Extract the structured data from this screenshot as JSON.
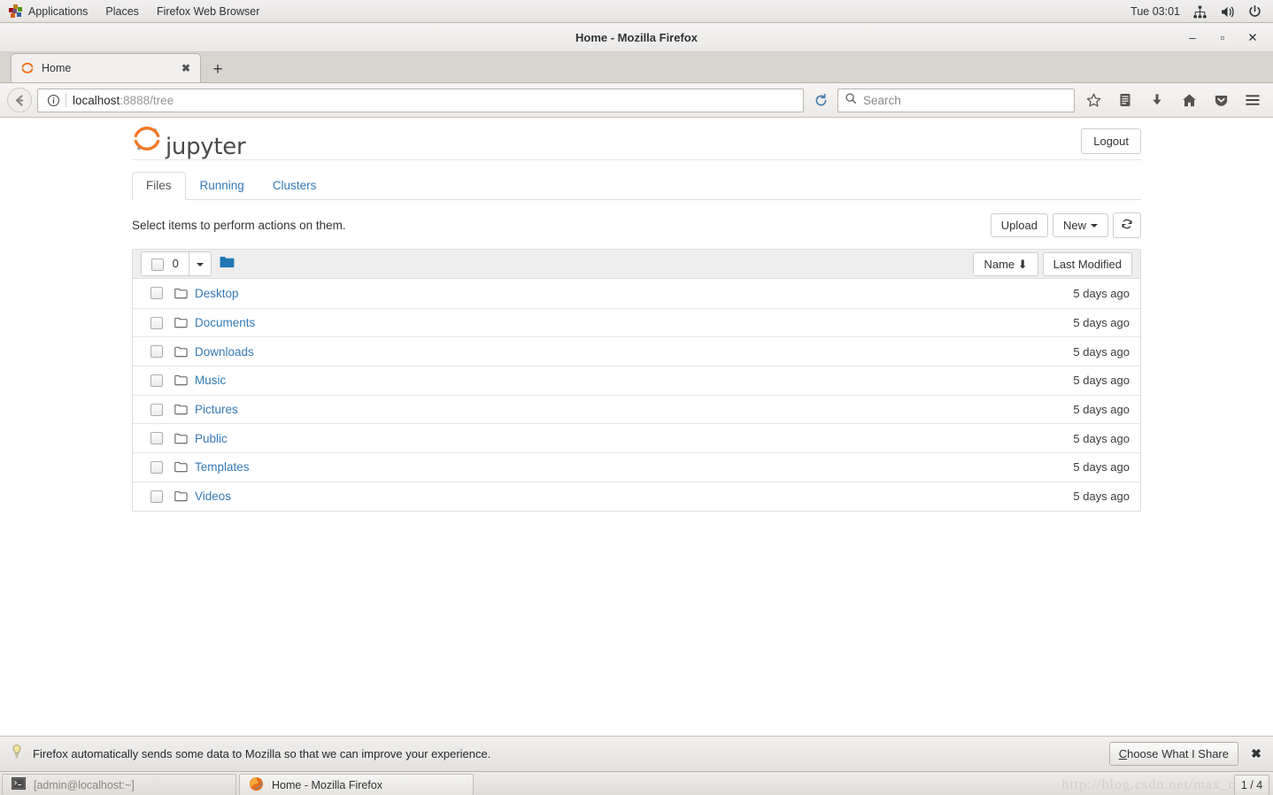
{
  "desktop_panel": {
    "menus": [
      "Applications",
      "Places",
      "Firefox Web Browser"
    ],
    "clock": "Tue 03:01",
    "tray_icons": [
      "network-icon",
      "volume-icon",
      "power-icon"
    ]
  },
  "browser": {
    "window_title": "Home - Mozilla Firefox",
    "window_controls": {
      "minimize": "–",
      "maximize": "▫",
      "close": "✕"
    },
    "tab": {
      "title": "Home",
      "close_label": "✖",
      "favicon": "jupyter-favicon"
    },
    "new_tab_label": "+",
    "url": {
      "host": "localhost",
      "rest": ":8888/tree"
    },
    "search": {
      "placeholder": "Search",
      "value": ""
    },
    "toolbar_icons": [
      "back-icon",
      "site-info-icon",
      "reload-icon",
      "search-icon",
      "bookmark-star-icon",
      "library-icon",
      "downloads-icon",
      "home-icon",
      "pocket-icon",
      "menu-icon"
    ]
  },
  "jupyter": {
    "brand": "jupyter",
    "logout_label": "Logout",
    "tabs": [
      {
        "label": "Files",
        "active": true
      },
      {
        "label": "Running",
        "active": false
      },
      {
        "label": "Clusters",
        "active": false
      }
    ],
    "select_message": "Select items to perform actions on them.",
    "actions": {
      "upload_label": "Upload",
      "new_label": "New",
      "refresh_label": "refresh-icon"
    },
    "list_toolbar": {
      "selected_count": "0",
      "dropdown_caret": "▾",
      "folder_icon": "folder-filled-icon",
      "sort_name_label": "Name",
      "sort_name_arrow": "⬇",
      "sort_modified_label": "Last Modified"
    },
    "columns": [
      "Name",
      "Last Modified"
    ],
    "files": [
      {
        "name": "Desktop",
        "icon": "folder-icon",
        "modified": "5 days ago"
      },
      {
        "name": "Documents",
        "icon": "folder-icon",
        "modified": "5 days ago"
      },
      {
        "name": "Downloads",
        "icon": "folder-icon",
        "modified": "5 days ago"
      },
      {
        "name": "Music",
        "icon": "folder-icon",
        "modified": "5 days ago"
      },
      {
        "name": "Pictures",
        "icon": "folder-icon",
        "modified": "5 days ago"
      },
      {
        "name": "Public",
        "icon": "folder-icon",
        "modified": "5 days ago"
      },
      {
        "name": "Templates",
        "icon": "folder-icon",
        "modified": "5 days ago"
      },
      {
        "name": "Videos",
        "icon": "folder-icon",
        "modified": "5 days ago"
      }
    ]
  },
  "notification": {
    "icon": "lightbulb-icon",
    "text": "Firefox automatically sends some data to Mozilla so that we can improve your experience.",
    "button_accel": "C",
    "button_rest": "hoose What I Share",
    "close_label": "✖"
  },
  "taskbar": {
    "items": [
      {
        "label": "[admin@localhost:~]",
        "icon": "terminal-icon",
        "active": false
      },
      {
        "label": "Home - Mozilla Firefox",
        "icon": "firefox-icon",
        "active": true
      }
    ],
    "watermark": "http://blog.csdn.net/max_c",
    "workspace": "1 / 4"
  },
  "colors": {
    "jupyter_orange": "#F37726",
    "link_blue": "#337ab7",
    "folder_blue": "#2077b4",
    "panel_bg": "#e8e6e3"
  }
}
